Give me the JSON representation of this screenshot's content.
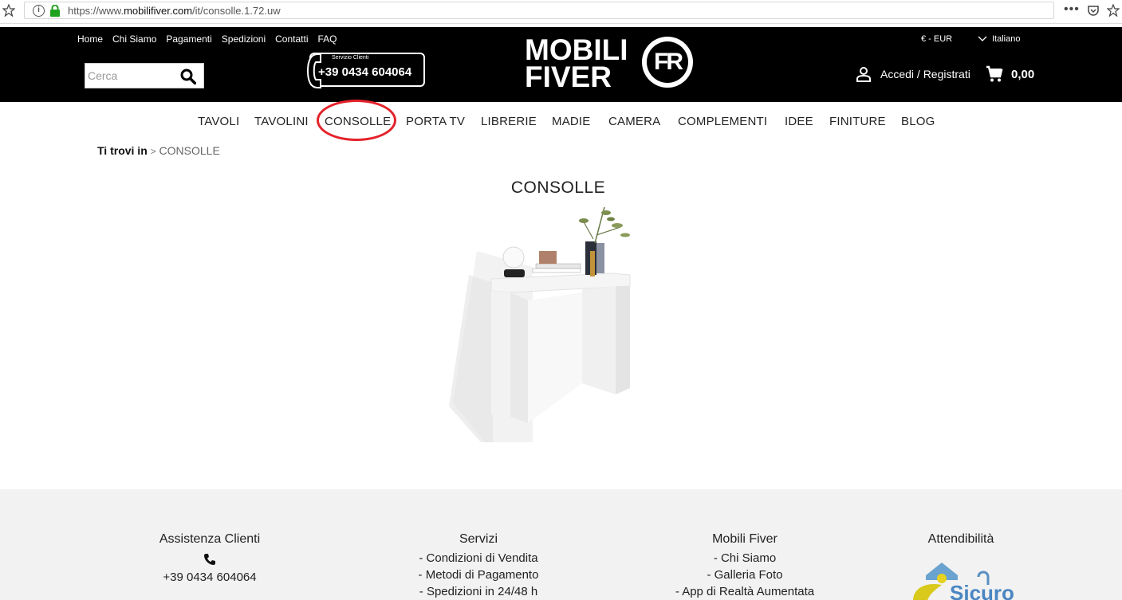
{
  "browser": {
    "url_prefix": "https://www.",
    "url_domain": "mobilifiver.com",
    "url_path": "/it/consolle.1.72.uw",
    "menu_dots": "•••"
  },
  "header": {
    "top_links": [
      "Home",
      "Chi Siamo",
      "Pagamenti",
      "Spedizioni",
      "Contatti",
      "FAQ"
    ],
    "search_placeholder": "Cerca",
    "phone_label": "Servizio Clienti",
    "phone_number": "+39 0434 604064",
    "logo_line1": "MOBILI",
    "logo_line2": "FIVER",
    "logo_badge": "FR",
    "currency": "€ - EUR",
    "language": "Italiano",
    "login": "Accedi / Registrati",
    "cart_total": "0,00"
  },
  "nav": {
    "items": [
      "TAVOLI",
      "TAVOLINI",
      "CONSOLLE",
      "PORTA TV",
      "LIBRERIE",
      "MADIE",
      "CAMERA",
      "COMPLEMENTI",
      "IDEE",
      "FINITURE",
      "BLOG"
    ]
  },
  "breadcrumb": {
    "label": "Ti trovi in",
    "separator": ">",
    "current": "CONSOLLE"
  },
  "page": {
    "title": "CONSOLLE"
  },
  "footer": {
    "assistenza": {
      "heading": "Assistenza Clienti",
      "phone": "+39 0434 604064"
    },
    "servizi": {
      "heading": "Servizi",
      "links": [
        "- Condizioni di Vendita",
        "- Metodi di Pagamento",
        "- Spedizioni in 24/48 h"
      ]
    },
    "mobili": {
      "heading": "Mobili Fiver",
      "links": [
        "- Chi Siamo",
        "- Galleria Foto",
        "- App di Realtà Aumentata"
      ]
    },
    "attendibilita": {
      "heading": "Attendibilità",
      "seal_text": "Sicuro"
    }
  },
  "colors": {
    "header_bg": "#000000",
    "highlight": "#e4222a",
    "footer_bg": "#f2f2f2"
  }
}
